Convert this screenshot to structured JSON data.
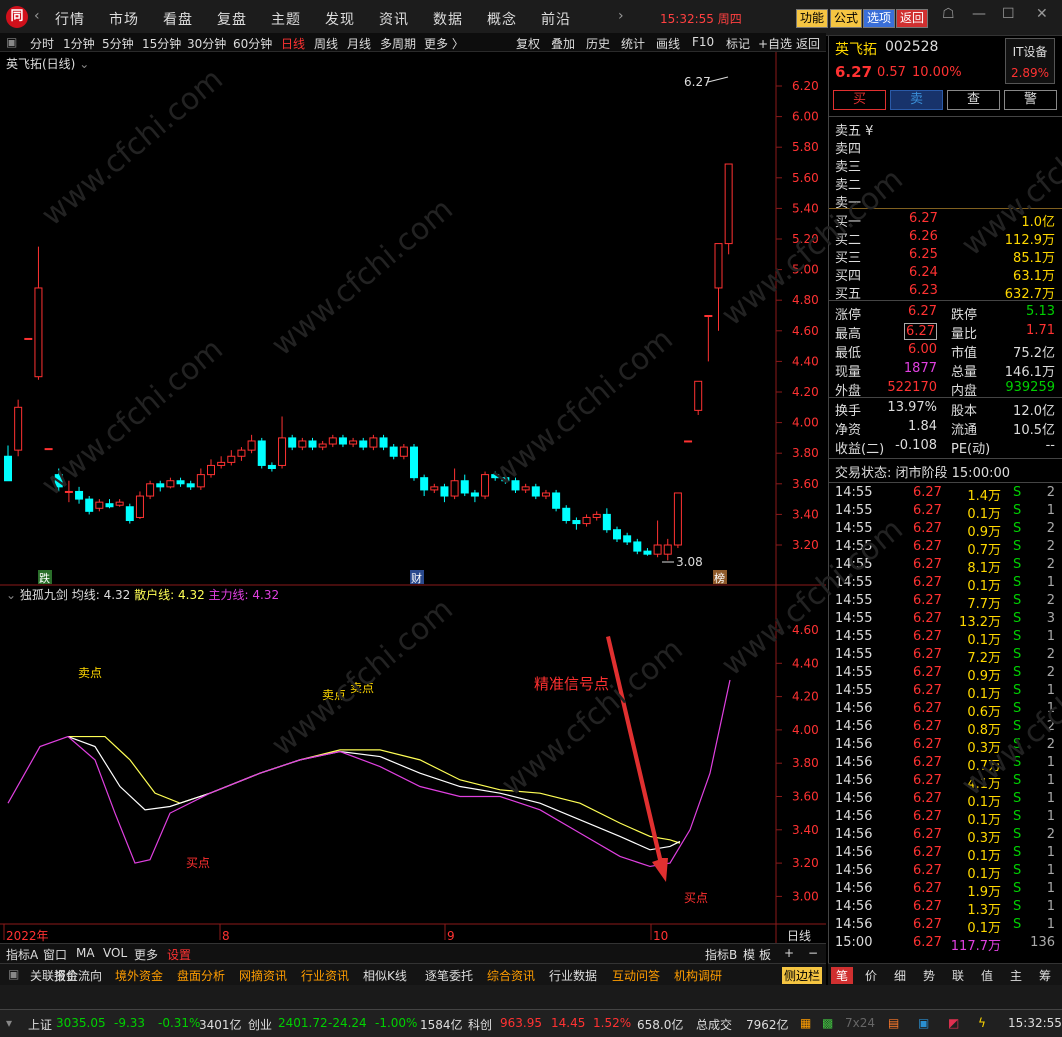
{
  "topbar": {
    "logo": "同",
    "menus": [
      "行情",
      "市场",
      "看盘",
      "复盘",
      "主题",
      "发现",
      "资讯",
      "数据",
      "概念",
      "前沿"
    ],
    "datetime": "15:32:55 周四",
    "buttons": [
      "功能",
      "公式",
      "选项",
      "返回"
    ]
  },
  "period_bar": {
    "items": [
      "分时",
      "1分钟",
      "5分钟",
      "15分钟",
      "30分钟",
      "60分钟",
      "日线",
      "周线",
      "月线",
      "多周期",
      "更多 〉"
    ],
    "active": "日线",
    "right": [
      "复权",
      "叠加",
      "历史",
      "统计",
      "画线",
      "F10",
      "标记",
      "+自选",
      "返回"
    ]
  },
  "chart": {
    "title": "英飞拓(日线)",
    "yaxis_main": [
      "6.20",
      "6.00",
      "5.80",
      "5.60",
      "5.40",
      "5.20",
      "5.00",
      "4.80",
      "4.60",
      "4.40",
      "4.20",
      "4.00",
      "3.80",
      "3.60",
      "3.40",
      "3.20"
    ],
    "high_label": "6.27",
    "low_label": "3.08",
    "markers": [
      "跌",
      "财",
      "榜"
    ]
  },
  "indicator": {
    "name": "独孤九剑",
    "avg_label": "均线: 4.32",
    "retail_label": "散户线: 4.32",
    "main_label": "主力线: 4.32",
    "yaxis": [
      "4.60",
      "4.40",
      "4.20",
      "4.00",
      "3.80",
      "3.60",
      "3.40",
      "3.20",
      "3.00"
    ],
    "annotations": {
      "sell": "卖点",
      "buy": "买点",
      "signal": "精准信号点"
    }
  },
  "xaxis": {
    "labels": [
      "2022年",
      "8",
      "9",
      "10"
    ],
    "right": "日线"
  },
  "indicator_tabs": [
    "指标A",
    "窗口",
    "MA",
    "VOL",
    "更多",
    "设置"
  ],
  "indicator_tabs_right": [
    "指标B",
    "模",
    "板",
    "+",
    "−"
  ],
  "bottom_tabs": [
    "关联报价",
    "资金流向",
    "境外资金",
    "盘面分析",
    "网摘资讯",
    "行业资讯",
    "相似K线",
    "逐笔委托",
    "综合资讯",
    "行业数据",
    "互动问答",
    "机构调研",
    "侧边栏"
  ],
  "side": {
    "name": "英飞拓",
    "code": "002528",
    "price": "6.27",
    "change": "0.57",
    "pct": "10.00%",
    "sector": "IT设备",
    "sector_pct": "2.89%",
    "trade_buttons": [
      "买",
      "卖",
      "查",
      "警"
    ],
    "asks": [
      "卖五 ¥",
      "卖四",
      "卖三",
      "卖二",
      "卖一"
    ],
    "bids": [
      [
        "买一",
        "6.27",
        "1.0亿"
      ],
      [
        "买二",
        "6.26",
        "112.9万"
      ],
      [
        "买三",
        "6.25",
        "85.1万"
      ],
      [
        "买四",
        "6.24",
        "63.1万"
      ],
      [
        "买五",
        "6.23",
        "632.7万"
      ]
    ],
    "stats": [
      [
        "涨停",
        "6.27",
        "跌停",
        "5.13"
      ],
      [
        "最高",
        "6.27",
        "量比",
        "1.71"
      ],
      [
        "最低",
        "6.00",
        "市值",
        "75.2亿"
      ],
      [
        "现量",
        "1877",
        "总量",
        "146.1万"
      ],
      [
        "外盘",
        "522170",
        "内盘",
        "939259"
      ]
    ],
    "stats2": [
      [
        "换手",
        "13.97%",
        "股本",
        "12.0亿"
      ],
      [
        "净资",
        "1.84",
        "流通",
        "10.5亿"
      ],
      [
        "收益(二)",
        "-0.108",
        "PE(动)",
        "--"
      ]
    ],
    "trade_status": "交易状态: 闭市阶段 15:00:00",
    "ticks": [
      [
        "14:55",
        "6.27",
        "1.4万",
        "S",
        "2"
      ],
      [
        "14:55",
        "6.27",
        "0.1万",
        "S",
        "1"
      ],
      [
        "14:55",
        "6.27",
        "0.9万",
        "S",
        "2"
      ],
      [
        "14:55",
        "6.27",
        "0.7万",
        "S",
        "2"
      ],
      [
        "14:55",
        "6.27",
        "8.1万",
        "S",
        "2"
      ],
      [
        "14:55",
        "6.27",
        "0.1万",
        "S",
        "1"
      ],
      [
        "14:55",
        "6.27",
        "7.7万",
        "S",
        "2"
      ],
      [
        "14:55",
        "6.27",
        "13.2万",
        "S",
        "3"
      ],
      [
        "14:55",
        "6.27",
        "0.1万",
        "S",
        "1"
      ],
      [
        "14:55",
        "6.27",
        "7.2万",
        "S",
        "2"
      ],
      [
        "14:55",
        "6.27",
        "0.9万",
        "S",
        "2"
      ],
      [
        "14:55",
        "6.27",
        "0.1万",
        "S",
        "1"
      ],
      [
        "14:56",
        "6.27",
        "0.6万",
        "S",
        "1"
      ],
      [
        "14:56",
        "6.27",
        "0.8万",
        "S",
        "2"
      ],
      [
        "14:56",
        "6.27",
        "0.3万",
        "S",
        "2"
      ],
      [
        "14:56",
        "6.27",
        "0.7万",
        "S",
        "1"
      ],
      [
        "14:56",
        "6.27",
        "4.1万",
        "S",
        "1"
      ],
      [
        "14:56",
        "6.27",
        "0.1万",
        "S",
        "1"
      ],
      [
        "14:56",
        "6.27",
        "0.1万",
        "S",
        "1"
      ],
      [
        "14:56",
        "6.27",
        "0.3万",
        "S",
        "2"
      ],
      [
        "14:56",
        "6.27",
        "0.1万",
        "S",
        "1"
      ],
      [
        "14:56",
        "6.27",
        "0.1万",
        "S",
        "1"
      ],
      [
        "14:56",
        "6.27",
        "1.9万",
        "S",
        "1"
      ],
      [
        "14:56",
        "6.27",
        "1.3万",
        "S",
        "1"
      ],
      [
        "14:56",
        "6.27",
        "0.1万",
        "S",
        "1"
      ],
      [
        "15:00",
        "6.27",
        "117.7万",
        "",
        "136"
      ]
    ],
    "side_tabs": [
      "笔",
      "价",
      "细",
      "势",
      "联",
      "值",
      "主",
      "筹"
    ]
  },
  "status": {
    "sh_label": "上证",
    "sh_val": "3035.05",
    "sh_chg": "-9.33",
    "sh_pct": "-0.31%",
    "sh_amt": "3401亿",
    "cy_label": "创业",
    "cy_val": "2401.72",
    "cy_chg": "-24.24",
    "cy_pct": "-1.00%",
    "cy_amt": "1584亿",
    "kc_label": "科创",
    "kc_val": "963.95",
    "kc_chg": "14.45",
    "kc_pct": "1.52%",
    "kc_amt": "658.0亿",
    "total_label": "总成交",
    "total_amt": "7962亿",
    "time": "15:32:55",
    "hours": "7x24"
  },
  "watermark": "www.cfchi.com",
  "colors": {
    "up": "#ff3232",
    "down": "#00ffff",
    "avg_line": "#ffffff",
    "retail_line": "#ffff55",
    "main_line": "#e040e0",
    "annot_red": "#ff3030"
  }
}
